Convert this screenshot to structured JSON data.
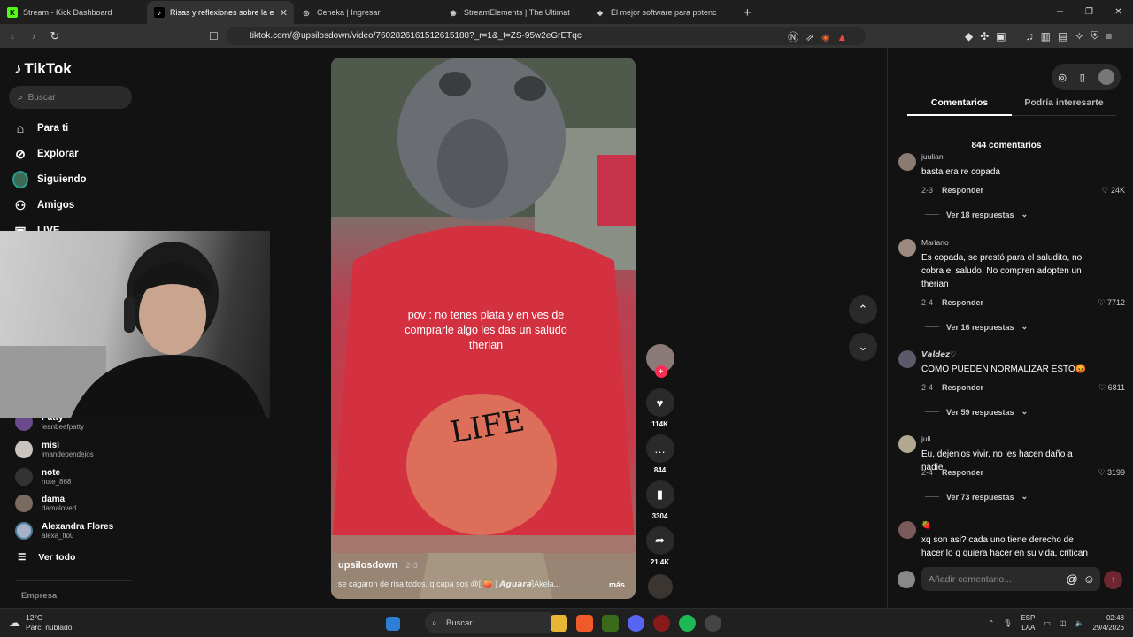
{
  "browser": {
    "tabs": [
      {
        "title": "Stream - Kick Dashboard",
        "active": false,
        "favicon": "kick-icon",
        "color": "#53fc18"
      },
      {
        "title": "Risas y reflexiones sobre la e",
        "active": true,
        "favicon": "tiktok-icon",
        "color": "#000000"
      },
      {
        "title": "Ceneka | Ingresar",
        "active": false,
        "favicon": "globe-icon",
        "color": "#666666"
      },
      {
        "title": "StreamElements | The Ultimate Strea",
        "active": false,
        "favicon": "streamelements-icon",
        "color": "#666666"
      },
      {
        "title": "El mejor software para potenciar tu st",
        "active": false,
        "favicon": "diamond-icon",
        "color": "#666666"
      }
    ],
    "url": "tiktok.com/@upsilosdown/video/7602826161512615188?_r=1&_t=ZS-95w2eGrETqc",
    "shield_badge": "2"
  },
  "sidebar": {
    "brand": "TikTok",
    "search_placeholder": "Buscar",
    "nav": [
      {
        "label": "Para ti",
        "icon": "home-icon"
      },
      {
        "label": "Explorar",
        "icon": "compass-icon"
      },
      {
        "label": "Siguiendo",
        "icon": "following-icon"
      },
      {
        "label": "Amigos",
        "icon": "friends-icon"
      },
      {
        "label": "LIVE",
        "icon": "live-icon"
      }
    ],
    "following": [
      {
        "name": "Patty",
        "handle": "leanbeefpatty",
        "color": "#6a4a8a"
      },
      {
        "name": "misi",
        "handle": "imandependejos",
        "color": "#c9c4c0"
      },
      {
        "name": "note",
        "handle": "note_868",
        "color": "#333333"
      },
      {
        "name": "dama",
        "handle": "damaloved",
        "color": "#7a6a60"
      },
      {
        "name": "Alexandra Flores",
        "handle": "alexa_flo0",
        "color": "#a6b2c8"
      }
    ],
    "see_all": "Ver todo",
    "footer": "Empresa"
  },
  "video": {
    "caption": "pov : no tenes plata y en ves de comprarle algo les das un saludo therian",
    "author": "upsilosdown",
    "date": "2-3",
    "description": "se cagaron de risa todos, q capa sos @[ 🍑 ] 𝘼𝙜𝙪𝙖𝙧𝙖́|Akela...",
    "more": "más",
    "likes": "114K",
    "comments": "844",
    "saves": "3304",
    "shares": "21.4K"
  },
  "panel": {
    "tabs": [
      "Comentarios",
      "Podría interesarte"
    ],
    "count_label": "844 comentarios",
    "reply_label": "Responder",
    "comments": [
      {
        "user": "juulian",
        "text": "basta era re copada",
        "date": "2-3",
        "likes": "24K",
        "replies": "Ver 18 respuestas",
        "color": "#8a7a70"
      },
      {
        "user": "Mariano",
        "text": "Es copada, se prestó para el saludito, no cobra el saludo. No compren adopten un therian",
        "date": "2-4",
        "likes": "7712",
        "replies": "Ver 16 respuestas",
        "color": "#9a8a80"
      },
      {
        "user": "𝙑𝙖𝙡𝙙𝙚𝙯♡",
        "text": "COMO PUEDEN NORMALIZAR ESTO😡",
        "date": "2-4",
        "likes": "6811",
        "replies": "Ver 59 respuestas",
        "color": "#5a5a6a"
      },
      {
        "user": "juli",
        "text": "Eu, dejenlos vivir, no les hacen daño a nadie",
        "date": "2-4",
        "likes": "3199",
        "replies": "Ver 73 respuestas",
        "color": "#b0a890"
      },
      {
        "user": "🍓",
        "text": "xq son asi? cada uno tiene derecho de hacer lo q quiera hacer en su vida, critican la suya xq",
        "date": "",
        "likes": "",
        "replies": "",
        "color": "#7a5a5a"
      }
    ],
    "input_placeholder": "Añadir comentario..."
  },
  "taskbar": {
    "temp": "12°C",
    "weather": "Parc. nublado",
    "search": "Buscar",
    "lang": "ESP",
    "lang2": "LAA",
    "time": "02:48",
    "date": "29/4/2026"
  }
}
